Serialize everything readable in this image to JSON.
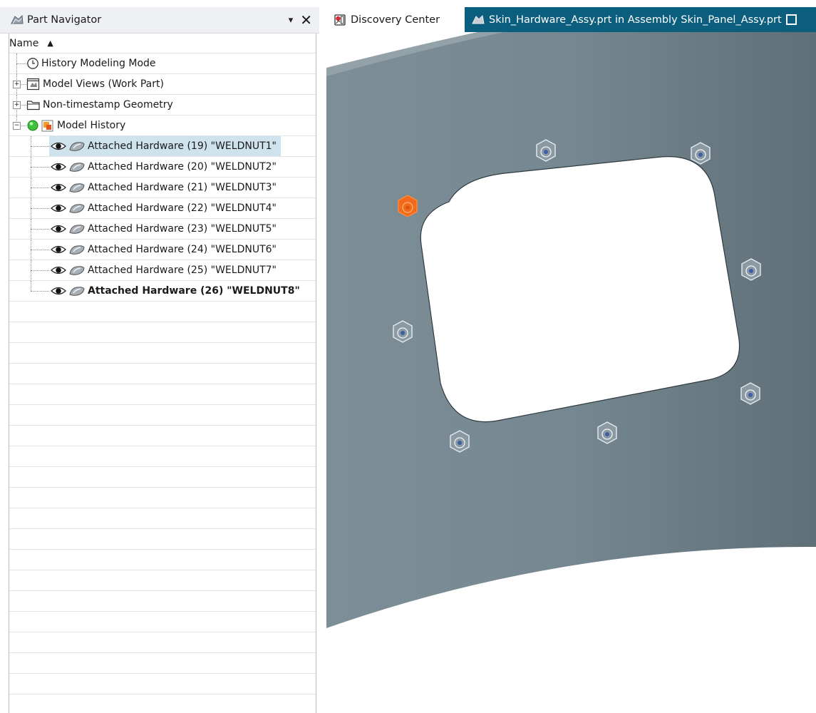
{
  "navigator": {
    "title": "Part Navigator",
    "menu_glyph": "▾",
    "close_glyph": "✕",
    "column_header": "Name",
    "sort_glyph": "▲",
    "items": [
      {
        "label": "History Modeling Mode",
        "icon": "clock-icon"
      },
      {
        "label": "Model Views (Work Part)",
        "icon": "model-views-icon",
        "expander": "+"
      },
      {
        "label": "Non-timestamp Geometry",
        "icon": "folder-icon",
        "expander": "+"
      },
      {
        "label": "Model History",
        "icon": "model-history-icon",
        "expander": "−"
      },
      {
        "label": "Attached Hardware (19) \"WELDNUT1\"",
        "selected": true
      },
      {
        "label": "Attached Hardware (20) \"WELDNUT2\""
      },
      {
        "label": "Attached Hardware (21) \"WELDNUT3\""
      },
      {
        "label": "Attached Hardware (22) \"WELDNUT4\""
      },
      {
        "label": "Attached Hardware (23) \"WELDNUT5\""
      },
      {
        "label": "Attached Hardware (24) \"WELDNUT6\""
      },
      {
        "label": "Attached Hardware (25) \"WELDNUT7\""
      },
      {
        "label": "Attached Hardware (26) \"WELDNUT8\"",
        "bold": true
      }
    ]
  },
  "tabs": [
    {
      "label": "Discovery Center",
      "icon": "discovery-center-icon",
      "active": false
    },
    {
      "label": "Skin_Hardware_Assy.prt in Assembly Skin_Panel_Assy.prt",
      "icon": "part-file-icon",
      "active": true
    }
  ],
  "colors": {
    "tab_bar": "#0b5e7e",
    "selection": "#cfe3ec",
    "panel": "#7a8b94",
    "highlight_nut": "#f26a1b"
  }
}
